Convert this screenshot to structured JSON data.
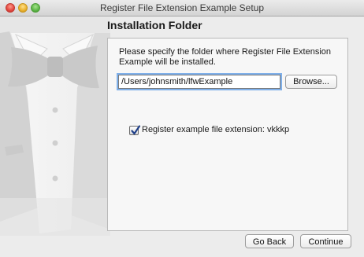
{
  "window": {
    "title": "Register File Extension Example Setup"
  },
  "page": {
    "heading": "Installation Folder",
    "description": "Please specify the folder where Register File Extension Example will be installed."
  },
  "folder": {
    "path_value": "/Users/johnsmith/lfwExample",
    "browse_label": "Browse..."
  },
  "options": {
    "register_extension_label": "Register example file extension: vkkkp",
    "register_extension_checked": true
  },
  "footer": {
    "back_label": "Go Back",
    "continue_label": "Continue"
  },
  "icons": {
    "art": "tuxedo-bowtie-icon",
    "check": "checkmark-icon"
  },
  "colors": {
    "focus_ring": "#7fb0ea",
    "check_mark": "#1f3f88",
    "close": "#e2463f",
    "minimize": "#e9b12d",
    "zoom": "#5cb646"
  }
}
